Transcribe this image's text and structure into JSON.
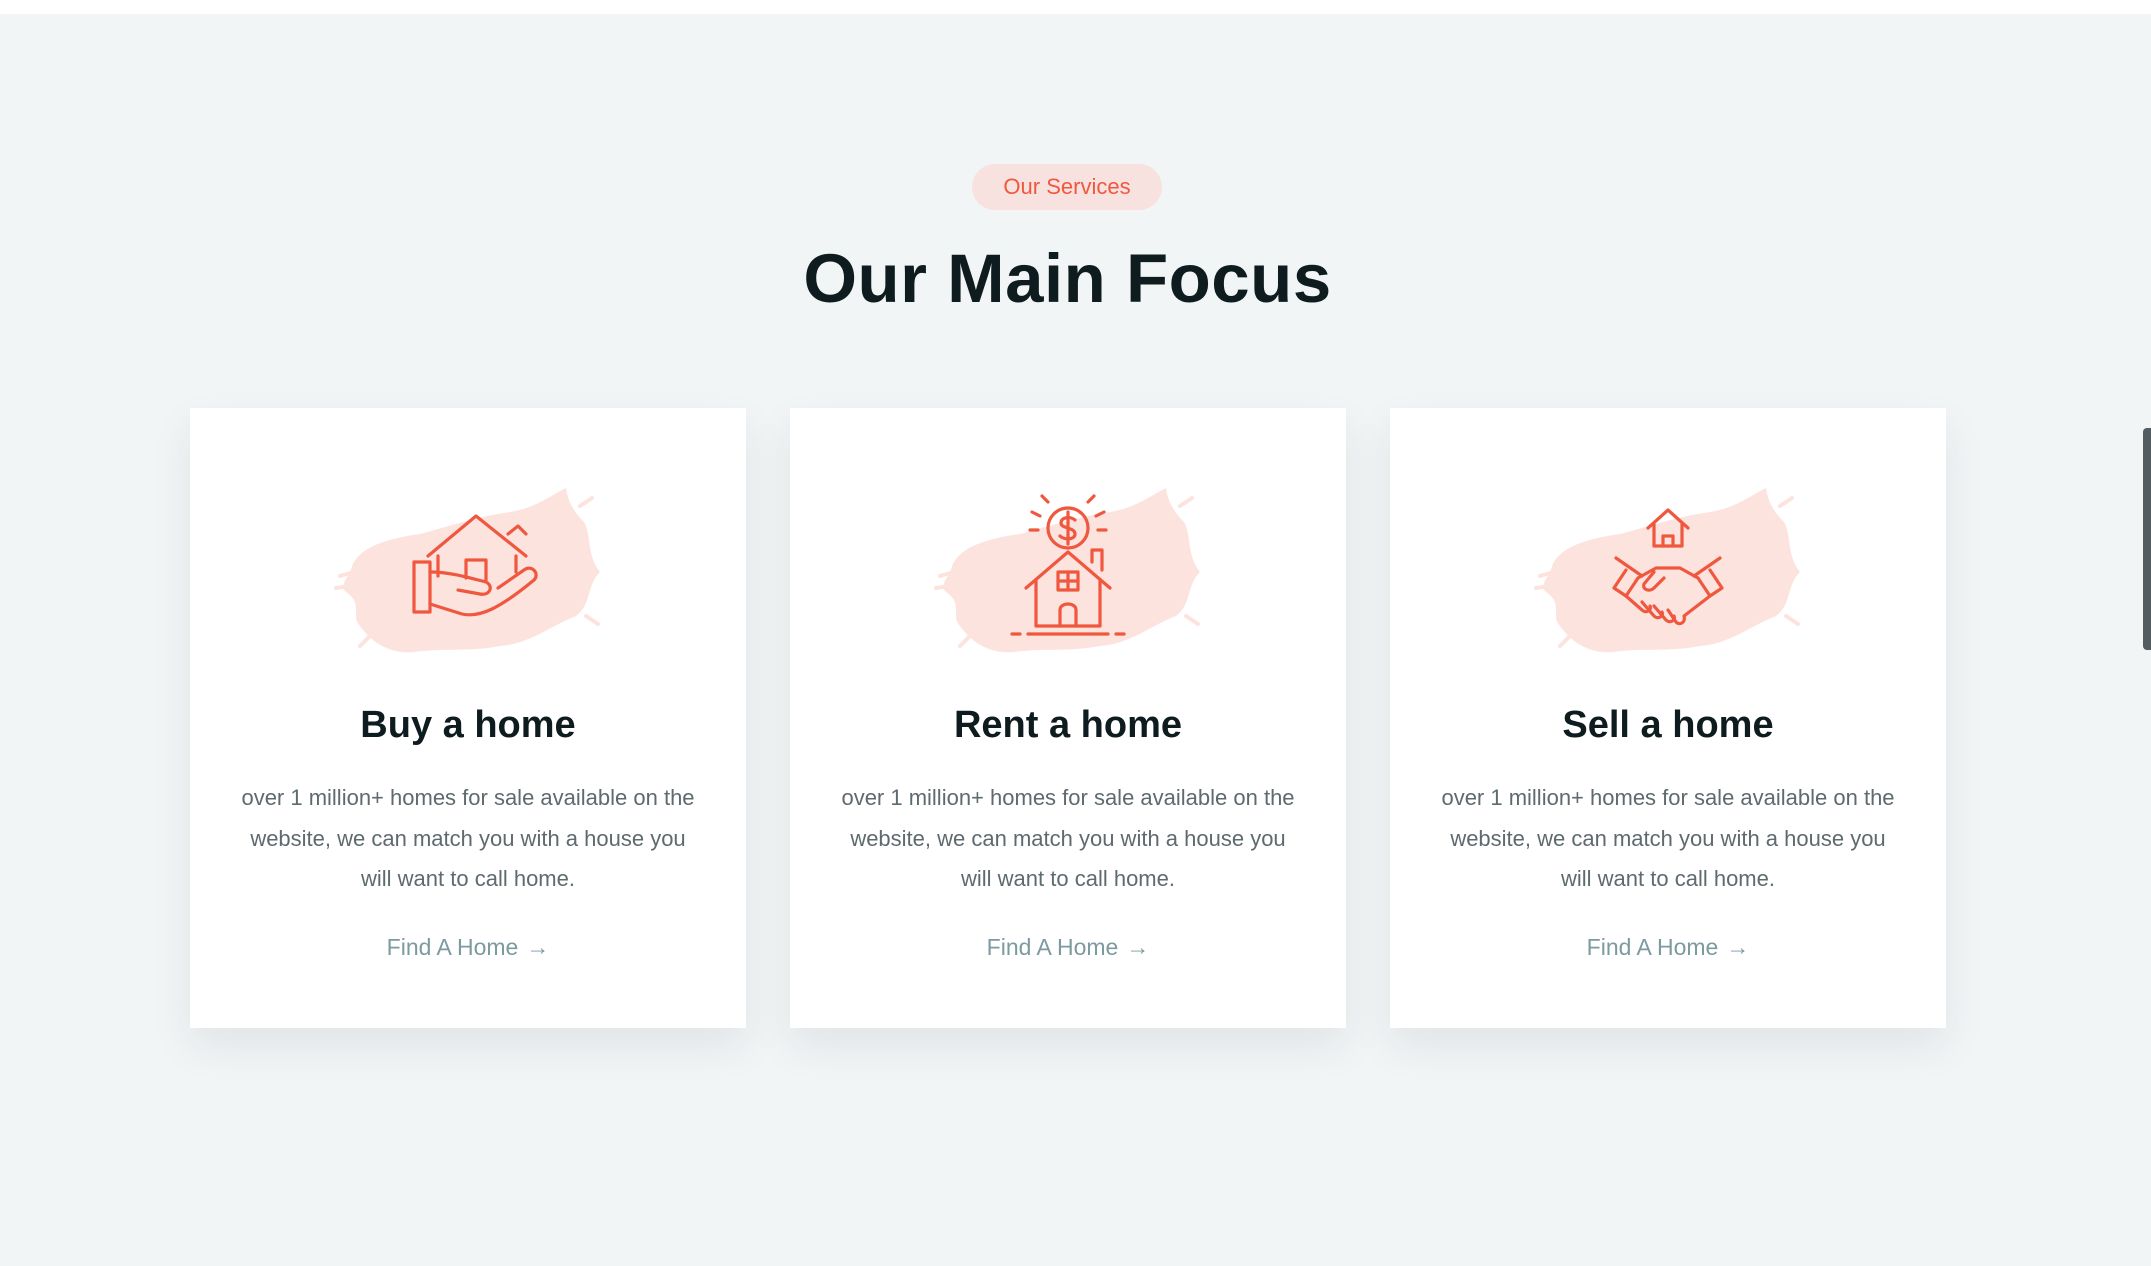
{
  "section": {
    "badge": "Our Services",
    "title": "Our Main Focus"
  },
  "cards": [
    {
      "icon": "house-in-hand-icon",
      "title": "Buy a home",
      "description": "over 1 million+ homes for sale available on the website, we can match you with a house you will want to call home.",
      "link_label": "Find A Home",
      "link_arrow": "→"
    },
    {
      "icon": "house-dollar-icon",
      "title": "Rent a home",
      "description": "over 1 million+ homes for sale available on the website, we can match you with a house you will want to call home.",
      "link_label": "Find A Home",
      "link_arrow": "→"
    },
    {
      "icon": "handshake-house-icon",
      "title": "Sell a home",
      "description": "over 1 million+ homes for sale available on the website, we can match you with a house you will want to call home.",
      "link_label": "Find A Home",
      "link_arrow": "→"
    }
  ],
  "colors": {
    "accent": "#f0573f",
    "badge_bg": "#f7e2df",
    "brush": "#fde3de",
    "heading": "#0e1b1f",
    "link": "#7d9aa0",
    "section_bg": "#f2f5f6"
  }
}
